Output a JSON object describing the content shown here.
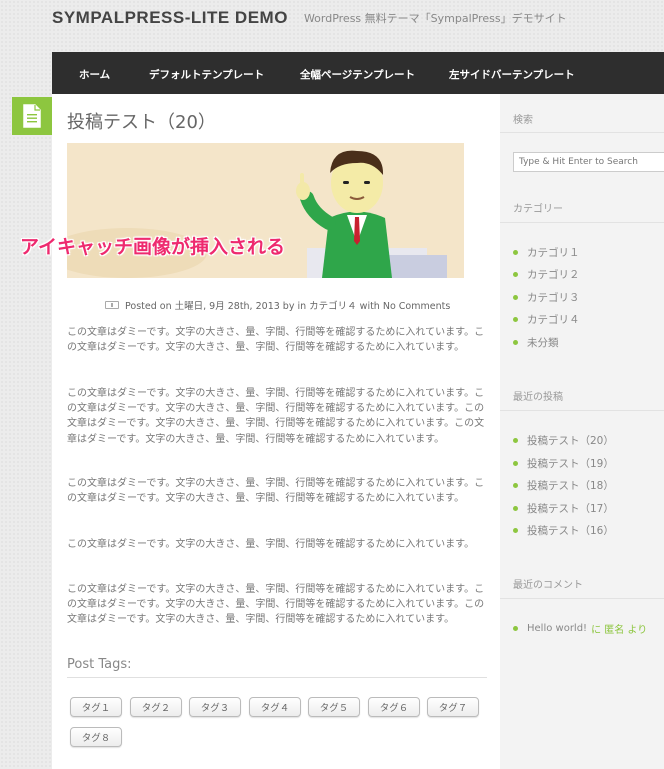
{
  "site": {
    "title": "SYMPALPRESS-LITE DEMO",
    "description": "WordPress 無料テーマ「SympalPress」デモサイト"
  },
  "nav": {
    "items": [
      "ホーム",
      "デフォルトテンプレート",
      "全幅ページテンプレート",
      "左サイドバーテンプレート"
    ]
  },
  "post": {
    "title": "投稿テスト（20）",
    "eyecatch_label": "アイキャッチ画像が挿入される",
    "meta": "Posted on 土曜日, 9月 28th, 2013 by in カテゴリ４ with No Comments",
    "paragraphs": [
      "この文章はダミーです。文字の大きさ、量、字間、行間等を確認するために入れています。この文章はダミーです。文字の大きさ、量、字間、行間等を確認するために入れています。",
      "この文章はダミーです。文字の大きさ、量、字間、行間等を確認するために入れています。この文章はダミーです。文字の大きさ、量、字間、行間等を確認するために入れています。この文章はダミーです。文字の大きさ、量、字間、行間等を確認するために入れています。この文章はダミーです。文字の大きさ、量、字間、行間等を確認するために入れています。",
      "この文章はダミーです。文字の大きさ、量、字間、行間等を確認するために入れています。この文章はダミーです。文字の大きさ、量、字間、行間等を確認するために入れています。",
      "この文章はダミーです。文字の大きさ、量、字間、行間等を確認するために入れています。",
      "この文章はダミーです。文字の大きさ、量、字間、行間等を確認するために入れています。この文章はダミーです。文字の大きさ、量、字間、行間等を確認するために入れています。この文章はダミーです。文字の大きさ、量、字間、行間等を確認するために入れています。"
    ],
    "tags_heading": "Post Tags:",
    "tags": [
      "タグ１",
      "タグ２",
      "タグ３",
      "タグ４",
      "タグ５",
      "タグ６",
      "タグ７",
      "タグ８"
    ]
  },
  "sidebar": {
    "search_heading": "検索",
    "search_placeholder": "Type & Hit Enter to Search",
    "categories_heading": "カテゴリー",
    "categories": [
      "カテゴリ１",
      "カテゴリ２",
      "カテゴリ３",
      "カテゴリ４",
      "未分類"
    ],
    "recent_posts_heading": "最近の投稿",
    "recent_posts": [
      "投稿テスト（20）",
      "投稿テスト（19）",
      "投稿テスト（18）",
      "投稿テスト（17）",
      "投稿テスト（16）"
    ],
    "recent_comments_heading": "最近のコメント",
    "recent_comment": {
      "post": "Hello world!",
      "link_text": "に 匿名 より"
    }
  },
  "colors": {
    "accent": "#8dc63f",
    "nav_bg": "#2e2e2e",
    "eyecatch_label": "#ee2a6f"
  }
}
